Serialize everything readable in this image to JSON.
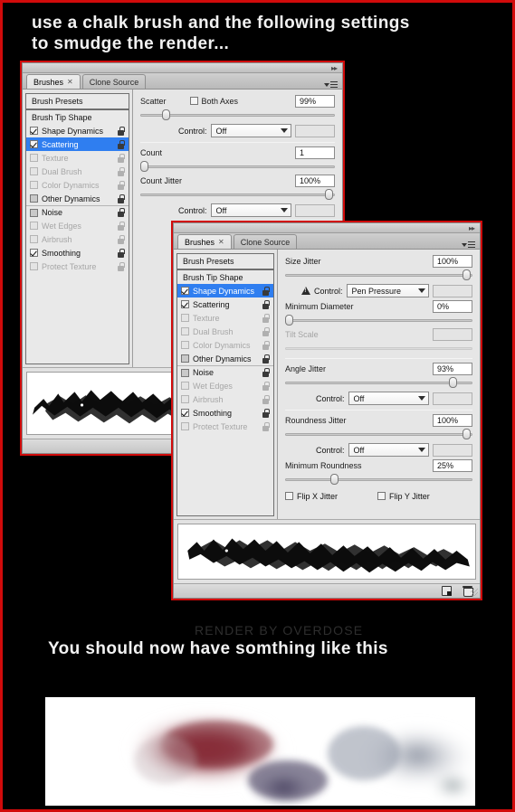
{
  "tutorial": {
    "caption_line1": "use a chalk brush and the following settings",
    "caption_line2": "to smudge the render...",
    "caption_bottom": "You should now have somthing like this",
    "watermark": "RENDER BY OVERDOSE"
  },
  "colors": {
    "border_red": "#d10b0b",
    "background": "#000000",
    "selection_blue": "#2f7ef0",
    "panel_gray": "#e6e6e6"
  },
  "panel_common": {
    "tabs": [
      {
        "label": "Brushes",
        "closable": true,
        "active": true
      },
      {
        "label": "Clone Source",
        "closable": false,
        "active": false
      }
    ],
    "presets_label": "Brush Presets",
    "list_items": [
      {
        "label": "Brush Tip Shape",
        "checkbox": "none",
        "state": "normal",
        "lock": "none",
        "selected": false,
        "separator": false
      },
      {
        "label": "Shape Dynamics",
        "checkbox": "checked",
        "state": "normal",
        "lock": "unlocked",
        "selected": false,
        "separator": false
      },
      {
        "label": "Scattering",
        "checkbox": "checked",
        "state": "normal",
        "lock": "unlocked",
        "selected": false,
        "separator": false
      },
      {
        "label": "Texture",
        "checkbox": "empty",
        "state": "disabled",
        "lock": "locked",
        "selected": false,
        "separator": false
      },
      {
        "label": "Dual Brush",
        "checkbox": "empty",
        "state": "disabled",
        "lock": "locked",
        "selected": false,
        "separator": false
      },
      {
        "label": "Color Dynamics",
        "checkbox": "empty",
        "state": "disabled",
        "lock": "locked",
        "selected": false,
        "separator": false
      },
      {
        "label": "Other Dynamics",
        "checkbox": "half",
        "state": "normal",
        "lock": "unlocked",
        "selected": false,
        "separator": false
      },
      {
        "label": "Noise",
        "checkbox": "half",
        "state": "normal",
        "lock": "unlocked",
        "selected": false,
        "separator": true
      },
      {
        "label": "Wet Edges",
        "checkbox": "empty",
        "state": "disabled",
        "lock": "locked",
        "selected": false,
        "separator": false
      },
      {
        "label": "Airbrush",
        "checkbox": "empty",
        "state": "disabled",
        "lock": "locked",
        "selected": false,
        "separator": false
      },
      {
        "label": "Smoothing",
        "checkbox": "checked",
        "state": "normal",
        "lock": "unlocked",
        "selected": false,
        "separator": false
      },
      {
        "label": "Protect Texture",
        "checkbox": "empty",
        "state": "disabled",
        "lock": "locked",
        "selected": false,
        "separator": false
      }
    ],
    "footer": {
      "new_brush_icon": "new-brush-icon",
      "delete_brush_icon": "trash-icon"
    }
  },
  "panel_scattering": {
    "selected_list_item": "Scattering",
    "settings": {
      "scatter_label": "Scatter",
      "scatter_value": "99%",
      "scatter_slider_pct": 11,
      "both_axes_label": "Both Axes",
      "both_axes_checked": false,
      "scatter_control_label": "Control:",
      "scatter_control_value": "Off",
      "count_label": "Count",
      "count_value": "1",
      "count_slider_pct": 1,
      "count_jitter_label": "Count Jitter",
      "count_jitter_value": "100%",
      "count_jitter_slider_pct": 99,
      "count_control_label": "Control:",
      "count_control_value": "Off"
    }
  },
  "panel_shape_dynamics": {
    "selected_list_item": "Shape Dynamics",
    "settings": {
      "size_jitter_label": "Size Jitter",
      "size_jitter_value": "100%",
      "size_jitter_slider_pct": 99,
      "size_control_label": "Control:",
      "size_control_value": "Pen Pressure",
      "size_control_warning": true,
      "minimum_diameter_label": "Minimum Diameter",
      "minimum_diameter_value": "0%",
      "minimum_diameter_slider_pct": 0,
      "tilt_scale_label": "Tilt Scale",
      "tilt_scale_value": "",
      "tilt_scale_disabled": true,
      "angle_jitter_label": "Angle Jitter",
      "angle_jitter_value": "93%",
      "angle_jitter_slider_pct": 92,
      "angle_control_label": "Control:",
      "angle_control_value": "Off",
      "roundness_jitter_label": "Roundness Jitter",
      "roundness_jitter_value": "100%",
      "roundness_jitter_slider_pct": 99,
      "roundness_control_label": "Control:",
      "roundness_control_value": "Off",
      "minimum_roundness_label": "Minimum Roundness",
      "minimum_roundness_value": "25%",
      "minimum_roundness_slider_pct": 24,
      "flip_x_label": "Flip X Jitter",
      "flip_x_checked": false,
      "flip_y_label": "Flip Y Jitter",
      "flip_y_checked": false
    }
  }
}
